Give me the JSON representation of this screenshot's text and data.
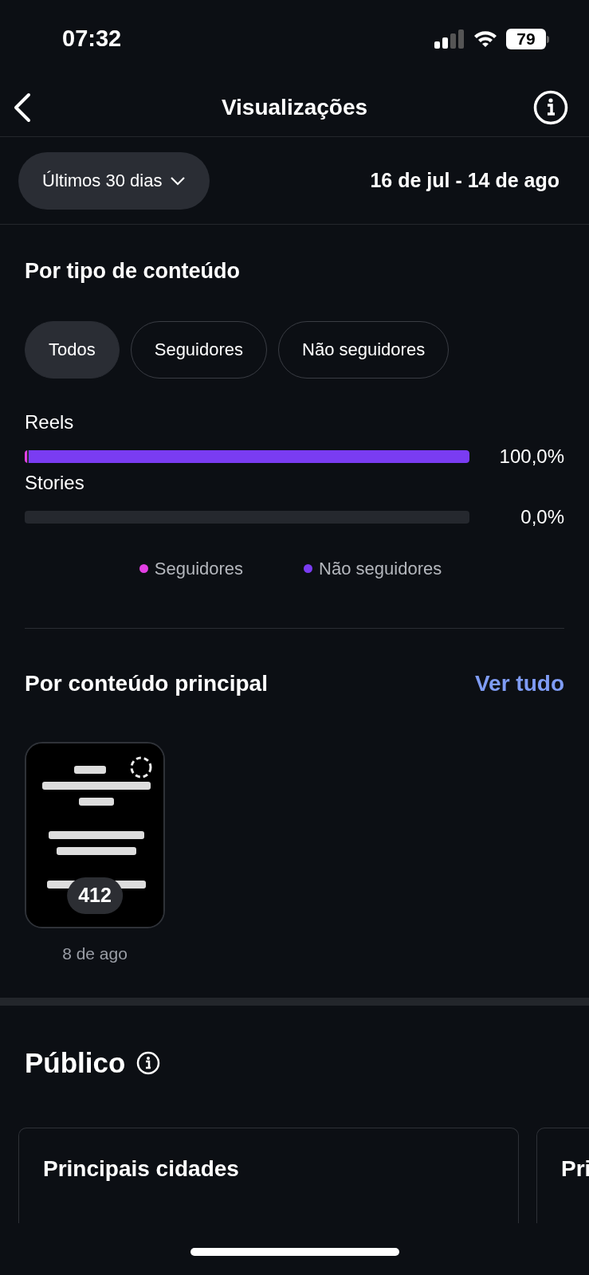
{
  "status_bar": {
    "time": "07:32",
    "battery": "79"
  },
  "header": {
    "title": "Visualizações"
  },
  "filter": {
    "period": "Últimos 30 dias",
    "range": "16 de jul - 14 de ago"
  },
  "content_type": {
    "title": "Por tipo de conteúdo",
    "tabs": [
      {
        "label": "Todos",
        "selected": true
      },
      {
        "label": "Seguidores",
        "selected": false
      },
      {
        "label": "Não seguidores",
        "selected": false
      }
    ],
    "rows": [
      {
        "label": "Reels",
        "percent": "100,0%",
        "segments": [
          {
            "level": 0.006
          },
          {
            "level": 0.994
          }
        ]
      },
      {
        "label": "Stories",
        "percent": "0,0%",
        "segments": [
          {
            "level": 0
          },
          {
            "level": 0
          }
        ]
      }
    ],
    "legend": [
      {
        "label": "Seguidores",
        "color": "#e23fe3"
      },
      {
        "label": "Não seguidores",
        "color": "#7a3cf2"
      }
    ]
  },
  "top_content": {
    "title": "Por conteúdo principal",
    "link": "Ver tudo",
    "items": [
      {
        "kind": "picture",
        "views": "412",
        "date": "8 de ago"
      }
    ]
  },
  "audience": {
    "title": "Público",
    "cards": [
      {
        "title": "Principais cidades"
      },
      {
        "title": "Pri"
      }
    ]
  }
}
